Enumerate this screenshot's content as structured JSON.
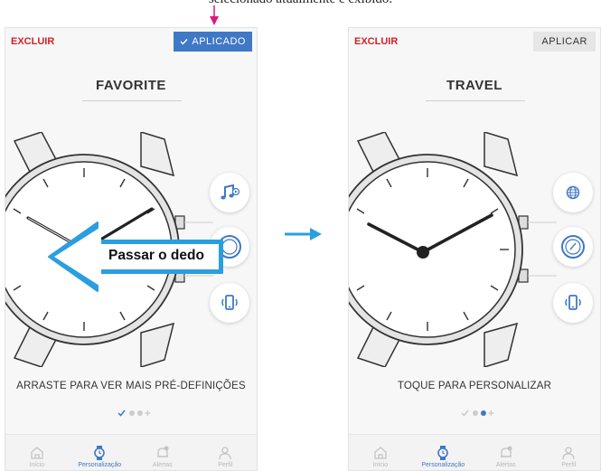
{
  "caption": "selecionado atualmente é exibido.",
  "colors": {
    "accent": "#3f78c6",
    "danger": "#d0232a",
    "pointer": "#e0157a",
    "swipe": "#2a9fdf"
  },
  "screens": [
    {
      "delete_label": "EXCLUIR",
      "action_label": "APLICADO",
      "action_state": "applied",
      "title": "FAVORITE",
      "complications": [
        "music-note-icon",
        "dial-icon",
        "phone-vibrate-icon"
      ],
      "hint": "ARRASTE PARA VER MAIS PRÉ-DEFINIÇÕES",
      "page_indicator": {
        "total": 3,
        "current": 1,
        "first_is_check": true
      },
      "swipe_label": "Passar o dedo"
    },
    {
      "delete_label": "EXCLUIR",
      "action_label": "APLICAR",
      "action_state": "apply",
      "title": "TRAVEL",
      "complications": [
        "globe-icon",
        "dial-icon",
        "phone-vibrate-icon"
      ],
      "hint": "TOQUE PARA PERSONALIZAR",
      "page_indicator": {
        "total": 3,
        "current": 3,
        "first_is_check": true
      }
    }
  ],
  "tabs": [
    {
      "label": "Início",
      "icon": "home-icon"
    },
    {
      "label": "Personalização",
      "icon": "watch-icon",
      "active": true
    },
    {
      "label": "Alertas",
      "icon": "bell-icon"
    },
    {
      "label": "Perfil",
      "icon": "user-icon"
    }
  ]
}
